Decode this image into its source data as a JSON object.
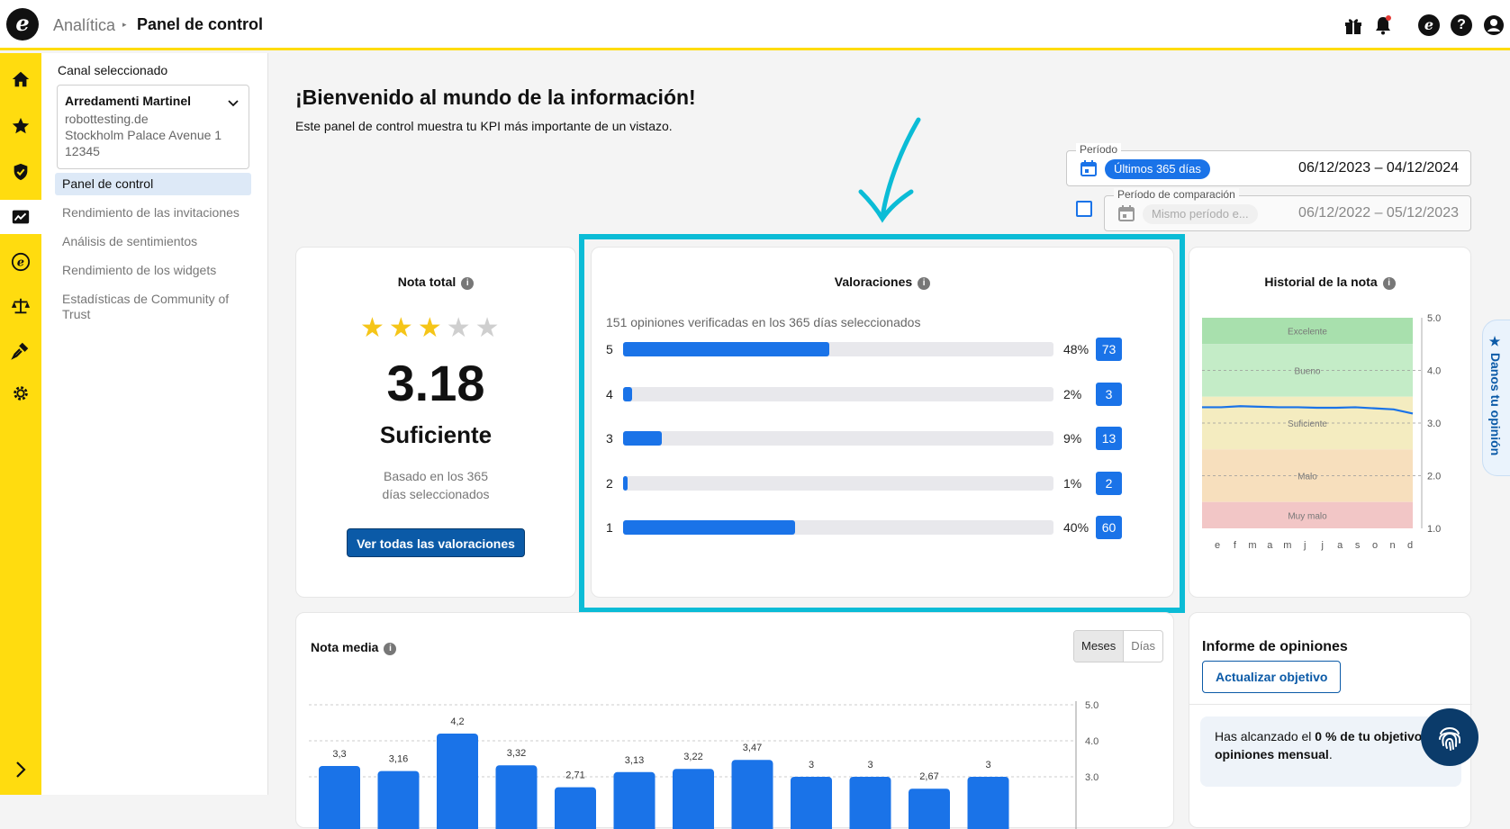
{
  "app": {
    "logo_glyph": "e",
    "breadcrumb_root": "Analítica",
    "breadcrumb_sep": "▸",
    "breadcrumb_current": "Panel de control",
    "header_icons": [
      "gift-icon",
      "bell-icon",
      "trusted-shops-icon",
      "help-icon",
      "user-icon"
    ]
  },
  "rail": {
    "icons": [
      "home-icon",
      "star-icon",
      "shield-icon",
      "analytics-icon",
      "trusted-shops-icon",
      "scale-icon",
      "plug-icon",
      "gear-icon",
      "chevron-right-icon"
    ],
    "active": "analytics-icon",
    "accent": "#ffdc0f"
  },
  "subnav": {
    "channel_label": "Canal seleccionado",
    "channel": {
      "name": "Arredamenti Martinel",
      "line1": "robottesting.de",
      "line2": "Stockholm Palace Avenue 1",
      "line3": "12345"
    },
    "items": [
      {
        "label": "Panel de control",
        "active": true
      },
      {
        "label": "Rendimiento de las invitaciones",
        "active": false
      },
      {
        "label": "Análisis de sentimientos",
        "active": false
      },
      {
        "label": "Rendimiento de los widgets",
        "active": false
      },
      {
        "label": "Estadísticas de Community of Trust",
        "active": false
      }
    ]
  },
  "main": {
    "title": "¡Bienvenido al mundo de la información!",
    "subtitle": "Este panel de control muestra tu KPI más importante de un vistazo.",
    "period": {
      "legend": "Período",
      "chip": "Últimos 365 días",
      "dates": "06/12/2023 – 04/12/2024"
    },
    "comparison": {
      "legend": "Período de comparación",
      "chip": "Mismo período e...",
      "dates": "06/12/2022 – 05/12/2023",
      "checked": false
    }
  },
  "total": {
    "title": "Nota total",
    "stars": {
      "filled": 3,
      "total": 5
    },
    "score": "3.18",
    "verdict": "Suficiente",
    "basis_line1": "Basado en los 365",
    "basis_line2": "días seleccionados",
    "button": "Ver todas las valoraciones"
  },
  "ratings": {
    "title": "Valoraciones",
    "summary": "151 opiniones verificadas en los 365 días seleccionados",
    "rows": [
      {
        "star": "5",
        "pct": "48%",
        "count": "73",
        "fraction": 0.48
      },
      {
        "star": "4",
        "pct": "2%",
        "count": "3",
        "fraction": 0.02
      },
      {
        "star": "3",
        "pct": "9%",
        "count": "13",
        "fraction": 0.09
      },
      {
        "star": "2",
        "pct": "1%",
        "count": "2",
        "fraction": 0.01
      },
      {
        "star": "1",
        "pct": "40%",
        "count": "60",
        "fraction": 0.4
      }
    ],
    "bar_color": "#1a73e8"
  },
  "history": {
    "title": "Historial de la nota",
    "bands": [
      {
        "label": "Excelente",
        "from": 4.5,
        "to": 5.0,
        "color": "#a8e0ad"
      },
      {
        "label": "Bueno",
        "from": 3.5,
        "to": 4.5,
        "color": "#c4ecc7"
      },
      {
        "label": "Suficiente",
        "from": 2.5,
        "to": 3.5,
        "color": "#f4ecc0"
      },
      {
        "label": "Malo",
        "from": 1.5,
        "to": 2.5,
        "color": "#f7dfbd"
      },
      {
        "label": "Muy malo",
        "from": 1.0,
        "to": 1.5,
        "color": "#f2c6c6"
      }
    ],
    "y_ticks": [
      "5.0",
      "4.0",
      "3.0",
      "2.0",
      "1.0"
    ],
    "x_ticks": [
      "e",
      "f",
      "m",
      "a",
      "m",
      "j",
      "j",
      "a",
      "s",
      "o",
      "n",
      "d"
    ]
  },
  "feedback_tab": "★ Danos tu opinión",
  "average": {
    "title": "Nota media",
    "toggle": {
      "months": "Meses",
      "days": "Días",
      "active": "Meses"
    },
    "y_ticks": [
      "5.0",
      "4.0",
      "3.0"
    ]
  },
  "report": {
    "title": "Informe de opiniones",
    "button": "Actualizar objetivo",
    "text_pre": "Has alcanzado el ",
    "text_bold": "0 % de tu objetivo de opiniones mensual",
    "text_post": "."
  },
  "chart_data": [
    {
      "type": "line",
      "title": "Historial de la nota",
      "x": [
        "e",
        "f",
        "m",
        "a",
        "m",
        "j",
        "j",
        "a",
        "s",
        "o",
        "n",
        "d"
      ],
      "series": [
        {
          "values": [
            3.3,
            3.3,
            3.32,
            3.31,
            3.3,
            3.3,
            3.29,
            3.29,
            3.3,
            3.28,
            3.26,
            3.18
          ]
        }
      ],
      "ylim": [
        1.0,
        5.0
      ],
      "color": "#1a73e8"
    },
    {
      "type": "bar",
      "title": "Nota media",
      "labels": [
        "3,3",
        "3,16",
        "4,2",
        "3,32",
        "2,71",
        "3,13",
        "3,22",
        "3,47",
        "3",
        "3",
        "2,67",
        "3"
      ],
      "values": [
        3.3,
        3.16,
        4.2,
        3.32,
        2.71,
        3.13,
        3.22,
        3.47,
        3,
        3,
        2.67,
        3
      ],
      "ylim": [
        3.0,
        5.0
      ],
      "color": "#1a73e8"
    }
  ]
}
